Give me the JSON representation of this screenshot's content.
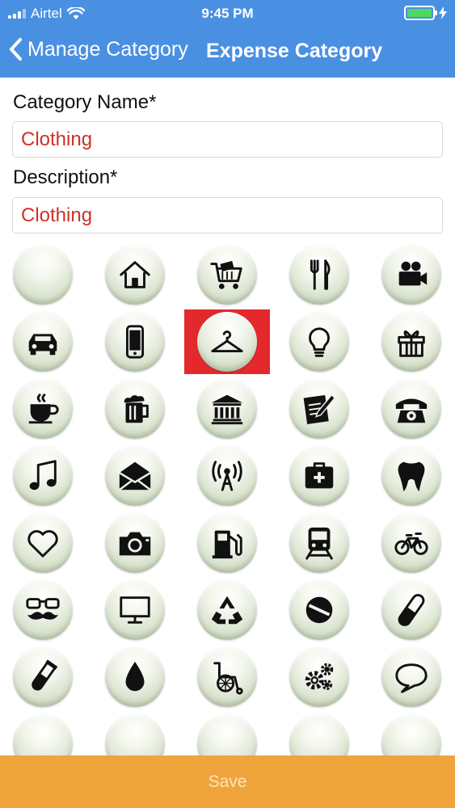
{
  "status_bar": {
    "carrier": "Airtel",
    "time": "9:45 PM"
  },
  "nav": {
    "back_label": "Manage Category",
    "title": "Expense Category"
  },
  "form": {
    "category_name_label": "Category Name*",
    "category_name_value": "Clothing",
    "description_label": "Description*",
    "description_value": "Clothing"
  },
  "icons": [
    "blank-icon",
    "home-icon",
    "shopping-cart-icon",
    "fork-knife-icon",
    "video-camera-icon",
    "car-icon",
    "mobile-phone-icon",
    "clothes-hanger-icon",
    "light-bulb-icon",
    "gift-icon",
    "coffee-cup-icon",
    "beer-mug-icon",
    "bank-icon",
    "notepad-pencil-icon",
    "telephone-icon",
    "music-note-icon",
    "envelope-icon",
    "antenna-icon",
    "first-aid-kit-icon",
    "tooth-icon",
    "heart-icon",
    "camera-icon",
    "fuel-pump-icon",
    "train-icon",
    "bicycle-icon",
    "glasses-mustache-icon",
    "monitor-icon",
    "recycle-icon",
    "pill-icon",
    "capsule-icon",
    "test-tube-icon",
    "drop-icon",
    "wheelchair-icon",
    "gears-icon",
    "speech-bubble-icon"
  ],
  "selected_icon": "clothes-hanger-icon",
  "colors": {
    "header": "#4a90e2",
    "selected": "#e3292c",
    "value_text": "#d0302a",
    "save_bar": "#f0a43c"
  },
  "save_label": "Save"
}
